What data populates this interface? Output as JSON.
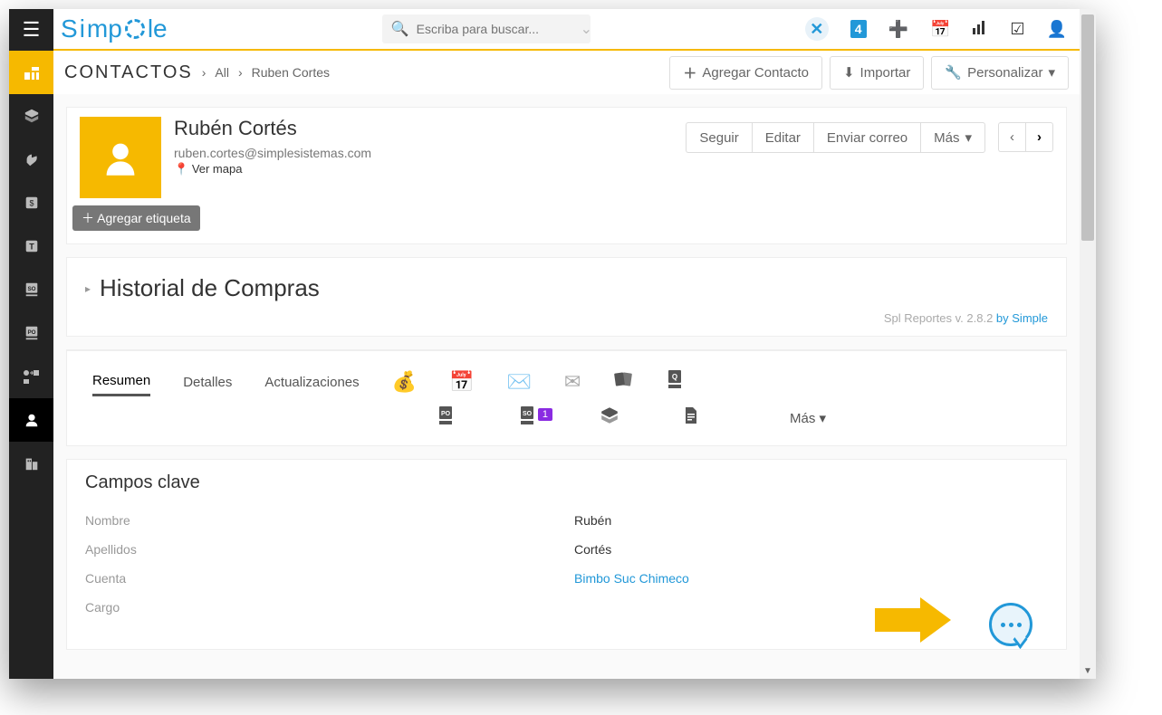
{
  "brand": "Simple",
  "search": {
    "placeholder": "Escriba para buscar..."
  },
  "crumb": {
    "module": "CONTACTOS",
    "all": "All",
    "name": "Ruben Cortes"
  },
  "topActions": {
    "add": "Agregar Contacto",
    "import": "Importar",
    "customize": "Personalizar"
  },
  "profile": {
    "name": "Rubén Cortés",
    "email": "ruben.cortes@simplesistemas.com",
    "map": "Ver mapa"
  },
  "profActions": {
    "follow": "Seguir",
    "edit": "Editar",
    "mail": "Enviar correo",
    "more": "Más"
  },
  "tag": "Agregar etiqueta",
  "history": {
    "title": "Historial de Compras",
    "ver": "Spl Reportes v. 2.8.2 ",
    "by": "by Simple"
  },
  "tabs": {
    "summary": "Resumen",
    "details": "Detalles",
    "updates": "Actualizaciones",
    "more": "Más",
    "badge": "1"
  },
  "keyFields": {
    "title": "Campos clave",
    "rows": [
      {
        "label": "Nombre",
        "value": "Rubén"
      },
      {
        "label": "Apellidos",
        "value": "Cortés"
      },
      {
        "label": "Cuenta",
        "value": "Bimbo Suc Chimeco",
        "link": true
      },
      {
        "label": "Cargo",
        "value": ""
      }
    ]
  },
  "topBadge": "4"
}
